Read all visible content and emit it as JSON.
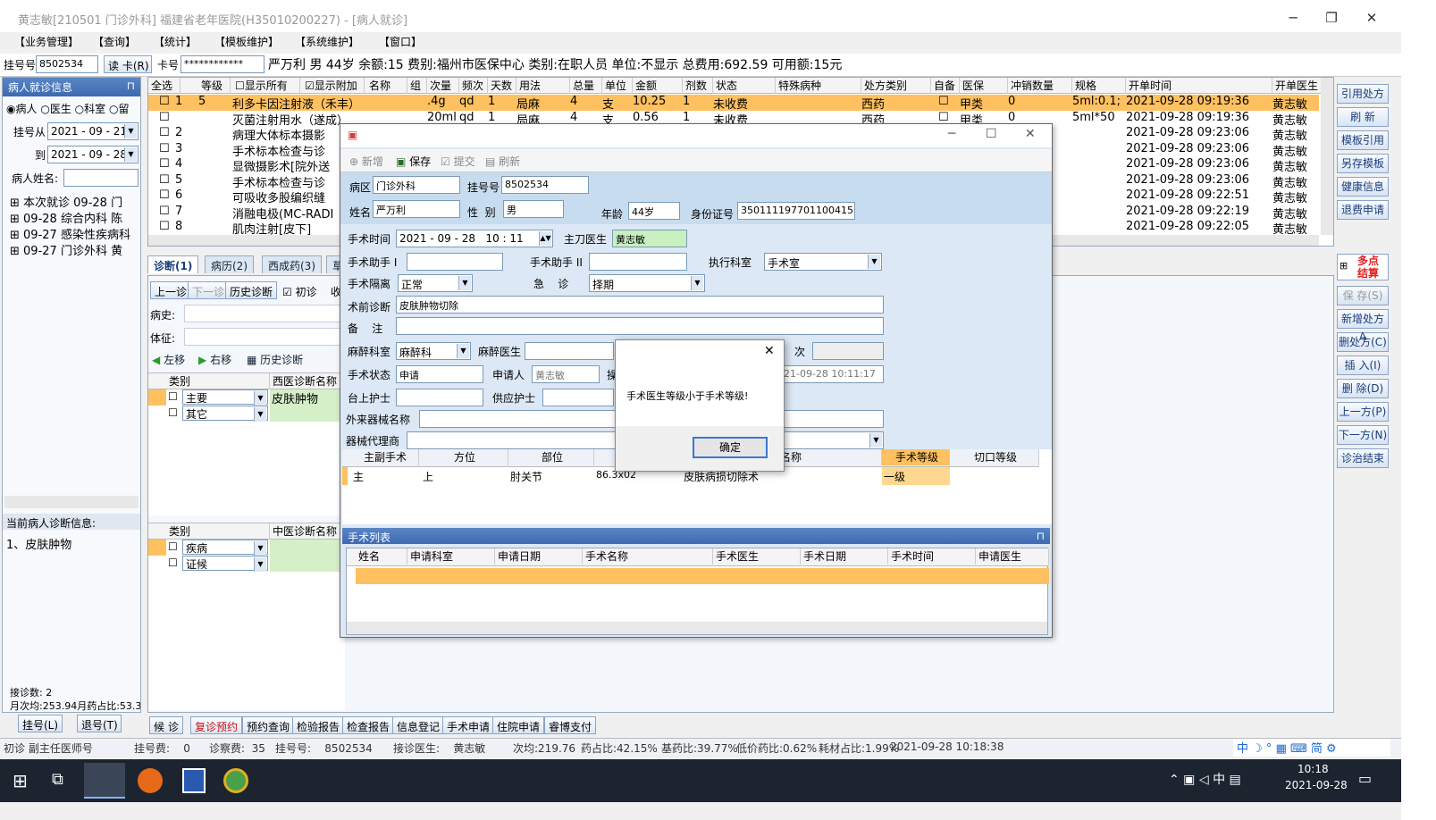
{
  "window": {
    "title": "黄志敏[210501 门诊外科] 福建省老年医院(H35010200227) - [病人就诊]"
  },
  "menu": [
    "【业务管理】",
    "【查询】",
    "【统计】",
    "【模板维护】",
    "【系统维护】",
    "【窗口】"
  ],
  "patientbar": {
    "reg_label": "挂号号",
    "reg_value": "8502534",
    "read_card": "读 卡(R)",
    "card_label": "卡号",
    "card_value": "************",
    "summary": "严万利  男  44岁  余额:15  费别:福州市医保中心  类别:在职人员  单位:不显示  总费用:692.59  可用额:15元"
  },
  "leftpanel": {
    "header": "病人就诊信息",
    "radio": [
      "病人",
      "医生",
      "科室",
      "留"
    ],
    "from_label": "挂号从",
    "from_date": "2021 - 09 - 21",
    "to_label": "到",
    "to_date": "2021 - 09 - 28",
    "name_label": "病人姓名:",
    "tree": [
      "本次就诊 09-28 门",
      "09-28 综合内科 陈",
      "09-27 感染性疾病科",
      "09-27 门诊外科 黄"
    ],
    "diag_header": "当前病人诊断信息:",
    "diag_text": "1、皮肤肿物",
    "count": "接诊数: 2",
    "avg": "月次均:253.94月药占比:53.3",
    "btn_reg": "挂号(L)",
    "btn_unreg": "退号(T)"
  },
  "rx": {
    "headers": [
      "全选",
      "等级",
      "显示所有",
      "显示附加",
      "名称",
      "组",
      "次量",
      "频次",
      "天数",
      "用法",
      "总量",
      "单位",
      "金额",
      "剂数",
      "状态",
      "特殊病种",
      "处方类别",
      "自备",
      "医保",
      "冲销数量",
      "规格",
      "开单时间",
      "开单医生"
    ],
    "rows": [
      {
        "n": "1",
        "lv": "5",
        "name": "利多卡因注射液（禾丰）",
        "dose": ".4g",
        "freq": "qd",
        "days": "1",
        "use": "局麻",
        "total": "4",
        "unit": "支",
        "amt": "10.25",
        "pk": "1",
        "status": "未收费",
        "cat": "西药",
        "ins": "甲类",
        "off": "0",
        "spec": "5ml:0.1;",
        "time": "2021-09-28 09:19:36",
        "doc": "黄志敏"
      },
      {
        "n": "",
        "lv": "",
        "name": "灭菌注射用水（遂成）",
        "dose": "20ml",
        "freq": "qd",
        "days": "1",
        "use": "局麻",
        "total": "4",
        "unit": "支",
        "amt": "0.56",
        "pk": "1",
        "status": "未收费",
        "cat": "西药",
        "ins": "甲类",
        "off": "0",
        "spec": "5ml*50",
        "time": "2021-09-28 09:19:36",
        "doc": "黄志敏"
      },
      {
        "n": "2",
        "lv": "",
        "name": "病理大体标本摄影",
        "dose": "",
        "freq": "",
        "days": "",
        "use": "",
        "total": "",
        "unit": "",
        "amt": "",
        "pk": "",
        "status": "",
        "cat": "",
        "ins": "",
        "off": "",
        "spec": "",
        "time": "2021-09-28 09:23:06",
        "doc": "黄志敏"
      },
      {
        "n": "3",
        "lv": "",
        "name": "手术标本检查与诊",
        "dose": "",
        "freq": "",
        "days": "",
        "use": "",
        "total": "",
        "unit": "",
        "amt": "",
        "pk": "",
        "status": "",
        "cat": "",
        "ins": "",
        "off": "",
        "spec": "",
        "time": "2021-09-28 09:23:06",
        "doc": "黄志敏"
      },
      {
        "n": "4",
        "lv": "",
        "name": "显微摄影术[院外送",
        "dose": "",
        "freq": "",
        "days": "",
        "use": "",
        "total": "",
        "unit": "",
        "amt": "",
        "pk": "",
        "status": "",
        "cat": "",
        "ins": "",
        "off": "",
        "spec": "",
        "time": "2021-09-28 09:23:06",
        "doc": "黄志敏"
      },
      {
        "n": "5",
        "lv": "",
        "name": "手术标本检查与诊",
        "dose": "",
        "freq": "",
        "days": "",
        "use": "",
        "total": "",
        "unit": "",
        "amt": "",
        "pk": "",
        "status": "",
        "cat": "",
        "ins": "",
        "off": "",
        "spec": "",
        "time": "2021-09-28 09:23:06",
        "doc": "黄志敏"
      },
      {
        "n": "6",
        "lv": "",
        "name": "可吸收多股编织缝",
        "dose": "",
        "freq": "",
        "days": "",
        "use": "",
        "total": "",
        "unit": "",
        "amt": "",
        "pk": "",
        "status": "",
        "cat": "",
        "ins": "",
        "off": "",
        "spec": "",
        "time": "2021-09-28 09:22:51",
        "doc": "黄志敏"
      },
      {
        "n": "7",
        "lv": "",
        "name": "消融电极(MC-RADI",
        "dose": "",
        "freq": "",
        "days": "",
        "use": "",
        "total": "",
        "unit": "",
        "amt": "",
        "pk": "",
        "status": "",
        "cat": "",
        "ins": "",
        "off": "",
        "spec": "",
        "time": "2021-09-28 09:22:19",
        "doc": "黄志敏"
      },
      {
        "n": "8",
        "lv": "",
        "name": "肌肉注射[皮下]",
        "dose": "",
        "freq": "",
        "days": "",
        "use": "",
        "total": "",
        "unit": "",
        "amt": "",
        "pk": "",
        "status": "",
        "cat": "",
        "ins": "",
        "off": "",
        "spec": "",
        "time": "2021-09-28 09:22:05",
        "doc": "黄志敏"
      }
    ]
  },
  "rightbtns": [
    "引用处方",
    "刷 新",
    "模板引用",
    "另存模板",
    "健康信息",
    "退费申请"
  ],
  "rightbtns2": {
    "multi": "多点结算",
    "list": [
      "保 存(S)",
      "新增处方A",
      "删处方(C)",
      "插 入(I)",
      "删 除(D)",
      "上一方(P)",
      "下一方(N)",
      "诊治结束"
    ]
  },
  "tabs": [
    "诊断(1)",
    "病历(2)",
    "西成药(3)",
    "草"
  ],
  "diag": {
    "prev": "上一诊",
    "next": "下一诊",
    "history": "历史诊断",
    "first": "初诊",
    "collect": "收",
    "history_label": "病史:",
    "sign_label": "体征:",
    "left": "左移",
    "right": "右移",
    "hist2": "历史诊断",
    "grid1_headers": [
      "类别",
      "西医诊断名称"
    ],
    "grid1_rows": [
      [
        "主要",
        "皮肤肿物"
      ],
      [
        "其它",
        ""
      ]
    ],
    "grid2_headers": [
      "类别",
      "中医诊断名称"
    ],
    "grid2_rows": [
      [
        "疾病",
        ""
      ],
      [
        "证候",
        ""
      ]
    ]
  },
  "bottombtns": [
    "候 诊",
    "复诊预约",
    "预约查询",
    "检验报告",
    "检查报告",
    "信息登记",
    "手术申请",
    "住院申请",
    "睿博支付"
  ],
  "status": {
    "left": "初诊 副主任医师号",
    "fee": "挂号费:    0",
    "diag_fee": "诊察费:  35",
    "reg_no": "挂号号:    8502534",
    "doctor": "接诊医生:    黄志敏",
    "avg": "次均:219.76",
    "drug_ratio": "药占比:42.15%",
    "base": "基药比:39.77%",
    "low": "低价药比:0.62%",
    "mat": "耗材占比:1.99%",
    "time": "2021-09-28 10:18:38"
  },
  "dialog": {
    "toolbar": [
      "新增",
      "保存",
      "提交",
      "刷新"
    ],
    "ward_label": "病区",
    "ward": "门诊外科",
    "reg_label": "挂号号",
    "reg": "8502534",
    "name_label": "姓名",
    "name": "严万利",
    "sex_label": "性  别",
    "sex": "男",
    "age_label": "年龄",
    "age": "44岁",
    "id_label": "身份证号",
    "id": "350111197701100415",
    "op_time_label": "手术时间",
    "op_time": "2021 - 09 - 28   10 : 11",
    "surgeon_label": "主刀医生",
    "surgeon": "黄志敏",
    "asst1_label": "手术助手 I",
    "asst2_label": "手术助手 II",
    "dept_label": "执行科室",
    "dept": "手术室",
    "iso_label": "手术隔离",
    "iso": "正常",
    "urg_label": "急    诊",
    "urg": "择期",
    "prediag_label": "术前诊断",
    "prediag": "皮肤肿物切除",
    "note_label": "备    注",
    "anes_dept_label": "麻醉科室",
    "anes_dept": "麻醉科",
    "anes_doc_label": "麻醉医生",
    "times_label": "次",
    "state_label": "手术状态",
    "state": "申请",
    "applicant_label": "申请人",
    "applicant": "黄志敏",
    "op_label": "操",
    "apply_time": "21-09-28 10:11:17",
    "nurse_label": "台上护士",
    "supply_label": "供应护士",
    "equip_label": "外来器械名称",
    "agent_label": "器械代理商",
    "grid_headers": [
      "主副手术",
      "方位",
      "部位",
      "",
      "名称",
      "手术等级",
      "切口等级"
    ],
    "grid_row": [
      "主",
      "上",
      "肘关节",
      "86.3x02",
      "皮肤病损切除术",
      "一级",
      ""
    ],
    "list_title": "手术列表",
    "list_headers": [
      "姓名",
      "申请科室",
      "申请日期",
      "手术名称",
      "手术医生",
      "手术日期",
      "手术时间",
      "申请医生"
    ]
  },
  "alert": {
    "message": "手术医生等级小于手术等级!",
    "ok": "确定"
  },
  "taskbar": {
    "time": "10:18",
    "date": "2021-09-28",
    "ime": "中"
  }
}
